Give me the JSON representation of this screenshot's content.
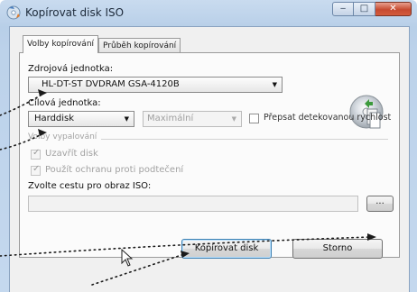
{
  "window": {
    "title": "Kopírovat disk ISO",
    "controls": {
      "minimize_glyph": "‒",
      "maximize_glyph": "□",
      "close_glyph": "✕"
    }
  },
  "tabs": [
    {
      "label": "Volby kopírování",
      "active": true
    },
    {
      "label": "Průběh kopírování",
      "active": false
    }
  ],
  "source": {
    "label": "Zdrojová jednotka:",
    "value": "HL-DT-ST DVDRAM GSA-4120B",
    "icon": "disc-copy-icon"
  },
  "target": {
    "label": "Cílová jednotka:",
    "value": "Harddisk",
    "speed_value": "Maximální",
    "overwrite_label": "Přepsat detekovanou rychlost"
  },
  "burn_options": {
    "label": "Volby vypalování",
    "close_disc_label": "Uzavřít disk",
    "protection_label": "Použít ochranu proti podtečení"
  },
  "iso_path": {
    "label": "Zvolte cestu pro obraz ISO:",
    "value": "",
    "browse_label": "..."
  },
  "buttons": {
    "copy_label": "Kopírovat disk",
    "close_label": "Storno"
  },
  "colors": {
    "annotation_arrows": "#1a1a1a",
    "default_button_border": "#3c7fb1"
  }
}
